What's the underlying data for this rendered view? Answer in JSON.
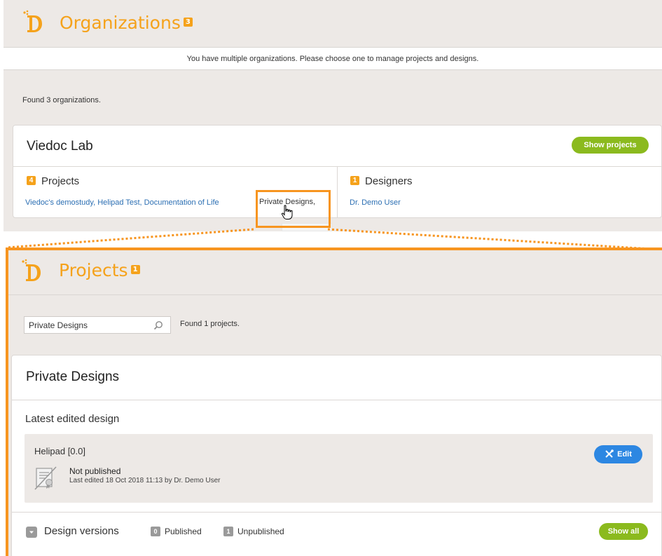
{
  "organizations": {
    "title": "Organizations",
    "count": "3",
    "info_message": "You have multiple organizations. Please choose one to manage projects and designs.",
    "found_text": "Found 3 organizations.",
    "card": {
      "name": "Viedoc Lab",
      "show_projects_label": "Show projects",
      "projects_heading": "Projects",
      "projects_count": "4",
      "project_links": "Viedoc's demostudy, Helipad Test, Documentation of Life",
      "hovered_project": "Private Designs,",
      "designers_heading": "Designers",
      "designers_count": "1",
      "designer_link": "Dr. Demo User"
    }
  },
  "projects": {
    "title": "Projects",
    "count": "1",
    "search_value": "Private Designs",
    "found_text": "Found 1 projects.",
    "card": {
      "name": "Private Designs",
      "latest_label": "Latest edited design",
      "design_name": "Helipad [0.0]",
      "design_status": "Not published",
      "design_edited": "Last edited 18 Oct 2018 11:13 by Dr. Demo User",
      "edit_label": "Edit",
      "versions_label": "Design versions",
      "published_count": "0",
      "published_label": "Published",
      "unpublished_count": "1",
      "unpublished_label": "Unpublished",
      "show_all_label": "Show all"
    }
  },
  "colors": {
    "brand_orange": "#f5a21b",
    "highlight_orange": "#f79520",
    "green": "#8bba1e",
    "blue": "#2d87e2",
    "link_blue": "#2c6fb3"
  },
  "icons": [
    "viedoc-logo-icon",
    "search-icon",
    "hand-cursor-icon",
    "edit-tools-icon",
    "unpublished-certificate-icon",
    "chevron-down-icon"
  ]
}
